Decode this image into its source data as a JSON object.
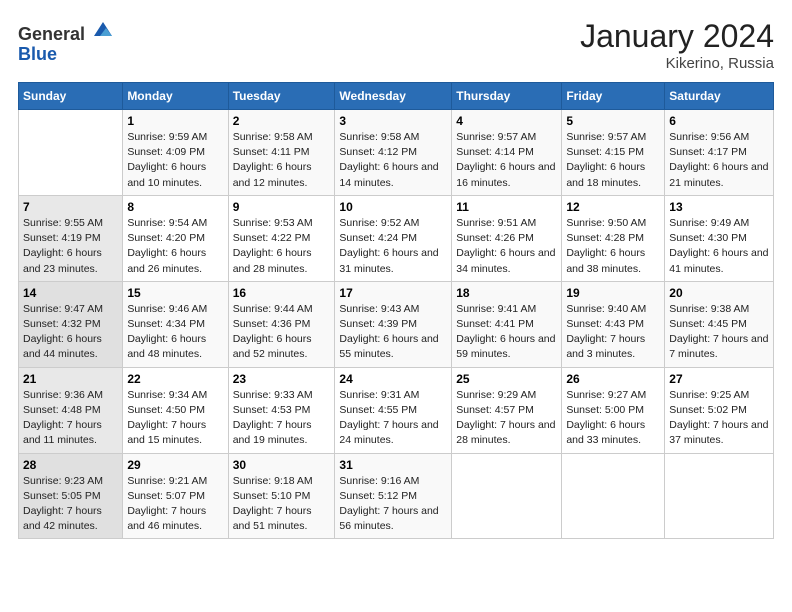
{
  "logo": {
    "general": "General",
    "blue": "Blue"
  },
  "title": "January 2024",
  "subtitle": "Kikerino, Russia",
  "headers": [
    "Sunday",
    "Monday",
    "Tuesday",
    "Wednesday",
    "Thursday",
    "Friday",
    "Saturday"
  ],
  "weeks": [
    [
      {
        "day": "",
        "sunrise": "",
        "sunset": "",
        "daylight": ""
      },
      {
        "day": "1",
        "sunrise": "Sunrise: 9:59 AM",
        "sunset": "Sunset: 4:09 PM",
        "daylight": "Daylight: 6 hours and 10 minutes."
      },
      {
        "day": "2",
        "sunrise": "Sunrise: 9:58 AM",
        "sunset": "Sunset: 4:11 PM",
        "daylight": "Daylight: 6 hours and 12 minutes."
      },
      {
        "day": "3",
        "sunrise": "Sunrise: 9:58 AM",
        "sunset": "Sunset: 4:12 PM",
        "daylight": "Daylight: 6 hours and 14 minutes."
      },
      {
        "day": "4",
        "sunrise": "Sunrise: 9:57 AM",
        "sunset": "Sunset: 4:14 PM",
        "daylight": "Daylight: 6 hours and 16 minutes."
      },
      {
        "day": "5",
        "sunrise": "Sunrise: 9:57 AM",
        "sunset": "Sunset: 4:15 PM",
        "daylight": "Daylight: 6 hours and 18 minutes."
      },
      {
        "day": "6",
        "sunrise": "Sunrise: 9:56 AM",
        "sunset": "Sunset: 4:17 PM",
        "daylight": "Daylight: 6 hours and 21 minutes."
      }
    ],
    [
      {
        "day": "7",
        "sunrise": "Sunrise: 9:55 AM",
        "sunset": "Sunset: 4:19 PM",
        "daylight": "Daylight: 6 hours and 23 minutes."
      },
      {
        "day": "8",
        "sunrise": "Sunrise: 9:54 AM",
        "sunset": "Sunset: 4:20 PM",
        "daylight": "Daylight: 6 hours and 26 minutes."
      },
      {
        "day": "9",
        "sunrise": "Sunrise: 9:53 AM",
        "sunset": "Sunset: 4:22 PM",
        "daylight": "Daylight: 6 hours and 28 minutes."
      },
      {
        "day": "10",
        "sunrise": "Sunrise: 9:52 AM",
        "sunset": "Sunset: 4:24 PM",
        "daylight": "Daylight: 6 hours and 31 minutes."
      },
      {
        "day": "11",
        "sunrise": "Sunrise: 9:51 AM",
        "sunset": "Sunset: 4:26 PM",
        "daylight": "Daylight: 6 hours and 34 minutes."
      },
      {
        "day": "12",
        "sunrise": "Sunrise: 9:50 AM",
        "sunset": "Sunset: 4:28 PM",
        "daylight": "Daylight: 6 hours and 38 minutes."
      },
      {
        "day": "13",
        "sunrise": "Sunrise: 9:49 AM",
        "sunset": "Sunset: 4:30 PM",
        "daylight": "Daylight: 6 hours and 41 minutes."
      }
    ],
    [
      {
        "day": "14",
        "sunrise": "Sunrise: 9:47 AM",
        "sunset": "Sunset: 4:32 PM",
        "daylight": "Daylight: 6 hours and 44 minutes."
      },
      {
        "day": "15",
        "sunrise": "Sunrise: 9:46 AM",
        "sunset": "Sunset: 4:34 PM",
        "daylight": "Daylight: 6 hours and 48 minutes."
      },
      {
        "day": "16",
        "sunrise": "Sunrise: 9:44 AM",
        "sunset": "Sunset: 4:36 PM",
        "daylight": "Daylight: 6 hours and 52 minutes."
      },
      {
        "day": "17",
        "sunrise": "Sunrise: 9:43 AM",
        "sunset": "Sunset: 4:39 PM",
        "daylight": "Daylight: 6 hours and 55 minutes."
      },
      {
        "day": "18",
        "sunrise": "Sunrise: 9:41 AM",
        "sunset": "Sunset: 4:41 PM",
        "daylight": "Daylight: 6 hours and 59 minutes."
      },
      {
        "day": "19",
        "sunrise": "Sunrise: 9:40 AM",
        "sunset": "Sunset: 4:43 PM",
        "daylight": "Daylight: 7 hours and 3 minutes."
      },
      {
        "day": "20",
        "sunrise": "Sunrise: 9:38 AM",
        "sunset": "Sunset: 4:45 PM",
        "daylight": "Daylight: 7 hours and 7 minutes."
      }
    ],
    [
      {
        "day": "21",
        "sunrise": "Sunrise: 9:36 AM",
        "sunset": "Sunset: 4:48 PM",
        "daylight": "Daylight: 7 hours and 11 minutes."
      },
      {
        "day": "22",
        "sunrise": "Sunrise: 9:34 AM",
        "sunset": "Sunset: 4:50 PM",
        "daylight": "Daylight: 7 hours and 15 minutes."
      },
      {
        "day": "23",
        "sunrise": "Sunrise: 9:33 AM",
        "sunset": "Sunset: 4:53 PM",
        "daylight": "Daylight: 7 hours and 19 minutes."
      },
      {
        "day": "24",
        "sunrise": "Sunrise: 9:31 AM",
        "sunset": "Sunset: 4:55 PM",
        "daylight": "Daylight: 7 hours and 24 minutes."
      },
      {
        "day": "25",
        "sunrise": "Sunrise: 9:29 AM",
        "sunset": "Sunset: 4:57 PM",
        "daylight": "Daylight: 7 hours and 28 minutes."
      },
      {
        "day": "26",
        "sunrise": "Sunrise: 9:27 AM",
        "sunset": "Sunset: 5:00 PM",
        "daylight": "Daylight: 6 hours and 33 minutes."
      },
      {
        "day": "27",
        "sunrise": "Sunrise: 9:25 AM",
        "sunset": "Sunset: 5:02 PM",
        "daylight": "Daylight: 7 hours and 37 minutes."
      }
    ],
    [
      {
        "day": "28",
        "sunrise": "Sunrise: 9:23 AM",
        "sunset": "Sunset: 5:05 PM",
        "daylight": "Daylight: 7 hours and 42 minutes."
      },
      {
        "day": "29",
        "sunrise": "Sunrise: 9:21 AM",
        "sunset": "Sunset: 5:07 PM",
        "daylight": "Daylight: 7 hours and 46 minutes."
      },
      {
        "day": "30",
        "sunrise": "Sunrise: 9:18 AM",
        "sunset": "Sunset: 5:10 PM",
        "daylight": "Daylight: 7 hours and 51 minutes."
      },
      {
        "day": "31",
        "sunrise": "Sunrise: 9:16 AM",
        "sunset": "Sunset: 5:12 PM",
        "daylight": "Daylight: 7 hours and 56 minutes."
      },
      {
        "day": "",
        "sunrise": "",
        "sunset": "",
        "daylight": ""
      },
      {
        "day": "",
        "sunrise": "",
        "sunset": "",
        "daylight": ""
      },
      {
        "day": "",
        "sunrise": "",
        "sunset": "",
        "daylight": ""
      }
    ]
  ]
}
